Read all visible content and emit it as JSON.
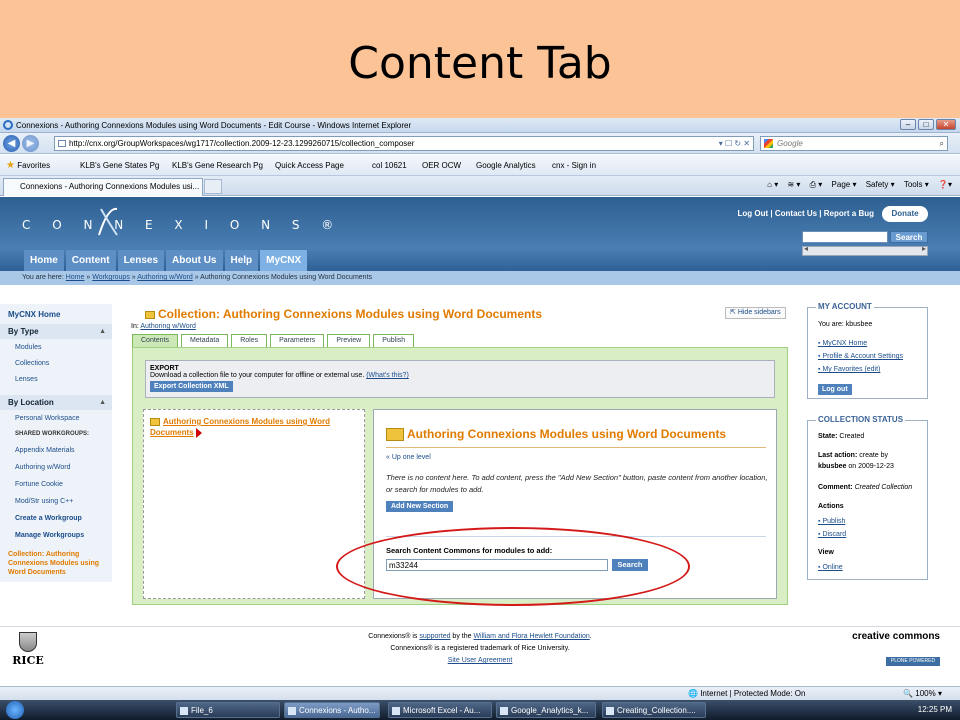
{
  "slide": {
    "title": "Content Tab"
  },
  "browser": {
    "window_title": "Connexions - Authoring Connexions Modules using Word Documents - Edit Course - Windows Internet Explorer",
    "url": "http://cnx.org/GroupWorkspaces/wg1717/collection.2009-12-23.1299260715/collection_composer",
    "search_placeholder": "Google",
    "favorites_label": "Favorites",
    "favorites": [
      "KLB's Gene States Pg",
      "KLB's Gene Research Pg",
      "Quick Access Page",
      "col 10621",
      "OER OCW",
      "Google Analytics",
      "cnx - Sign in"
    ],
    "tab_title": "Connexions - Authoring Connexions Modules usi...",
    "commands": [
      "Page ▾",
      "Safety ▾",
      "Tools ▾"
    ]
  },
  "site": {
    "logo": "CONNEXIONS",
    "top_links": "Log Out | Contact Us | Report a Bug",
    "donate": "Donate",
    "search_button": "Search",
    "nav": [
      "Home",
      "Content",
      "Lenses",
      "About Us",
      "Help",
      "MyCNX"
    ],
    "breadcrumb_prefix": "You are here: ",
    "breadcrumb": [
      "Home",
      "Workgroups",
      "Authoring w/Word"
    ],
    "breadcrumb_current": "Authoring Connexions Modules using Word Documents"
  },
  "left_sidebar": {
    "home": "MyCNX Home",
    "by_type": "By Type",
    "types": [
      "Modules",
      "Collections",
      "Lenses"
    ],
    "by_location": "By Location",
    "personal": "Personal Workspace",
    "shared_heading": "SHARED WORKGROUPS:",
    "workgroups": [
      "Appendix Materials",
      "Authoring w/Word",
      "Fortune Cookie",
      "Mod/Str using C++"
    ],
    "create": "Create a Workgroup",
    "manage": "Manage Workgroups",
    "current": "Collection: Authoring Connexions Modules using Word Documents"
  },
  "main": {
    "title": "Collection: Authoring Connexions Modules using Word Documents",
    "hide_sidebars": "Hide sidebars",
    "in_label": "In: ",
    "in_link": "Authoring w/Word",
    "tabs": [
      "Contents",
      "Metadata",
      "Roles",
      "Parameters",
      "Preview",
      "Publish"
    ],
    "export_heading": "EXPORT",
    "export_desc": "Download a collection file to your computer for offline or external use. ",
    "export_help": "(What's this?)",
    "export_button": "Export Collection XML",
    "tree_item": "Authoring Connexions Modules using Word Documents",
    "detail_title": "Authoring Connexions Modules using Word Documents",
    "up_one": "« Up one level",
    "no_content": "There is no content here. To add content, press the \"Add New Section\" button, paste content from another location, or search for modules to add.",
    "add_section": "Add New Section",
    "search_label": "Search Content Commons for modules to add:",
    "search_value": "m33244",
    "search_button": "Search"
  },
  "account": {
    "heading": "MY ACCOUNT",
    "user": "You are: kbusbee",
    "links": [
      "MyCNX Home",
      "Profile & Account Settings",
      "My Favorites (edit)"
    ],
    "logout": "Log out"
  },
  "status": {
    "heading": "COLLECTION STATUS",
    "state_label": "State:",
    "state": "Created",
    "last_action_label": "Last action:",
    "last_action": "create by",
    "last_user": "kbusbee",
    "last_date": "on 2009-12-23",
    "comment_label": "Comment:",
    "comment": "Created Collection",
    "actions_label": "Actions",
    "actions": [
      "Publish",
      "Discard"
    ],
    "view_label": "View",
    "views": [
      "Online"
    ]
  },
  "footer": {
    "line1_a": "Connexions® is ",
    "line1_link1": "supported",
    "line1_b": " by the ",
    "line1_link2": "William and Flora Hewlett Foundation",
    "line1_c": ".",
    "line2": "Connexions® is a registered trademark of Rice University.",
    "line3": "Site User Agreement",
    "rice": "RICE",
    "cc": "creative commons",
    "plone": "PLONE POWERED"
  },
  "statusbar": {
    "zone": "Internet | Protected Mode: On",
    "zoom": "100%"
  },
  "taskbar": {
    "items": [
      "File_6",
      "Connexions - Autho...",
      "Microsoft Excel - Au...",
      "Google_Analytics_k...",
      "Creating_Collection...."
    ],
    "clock": "12:25 PM"
  }
}
